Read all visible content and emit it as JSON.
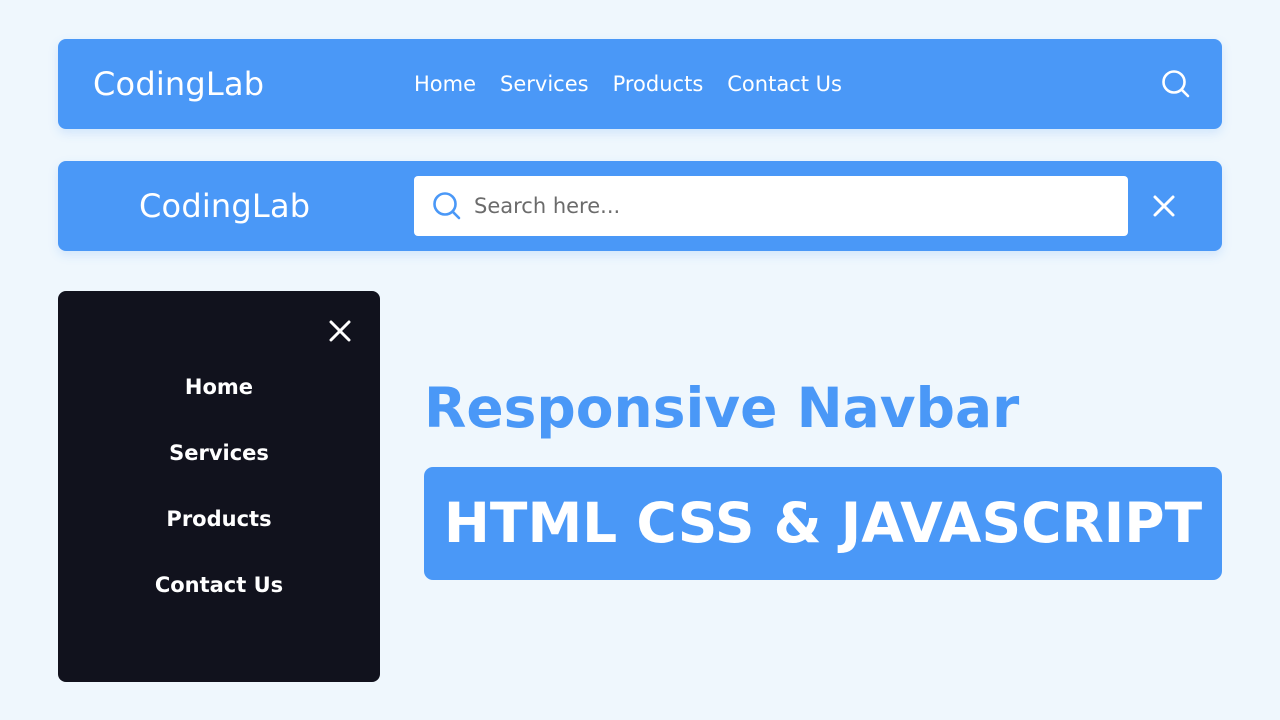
{
  "colors": {
    "background": "#EFF7FD",
    "brand_blue": "#4A98F7",
    "dark_panel": "#11121D",
    "white": "#FFFFFF"
  },
  "navbar_desktop": {
    "logo": "CodingLab",
    "links": [
      "Home",
      "Services",
      "Products",
      "Contact Us"
    ],
    "icon": "search-icon"
  },
  "navbar_search": {
    "logo": "CodingLab",
    "search_placeholder": "Search here...",
    "search_icon": "search-icon",
    "close_icon": "close-icon"
  },
  "mobile_menu": {
    "close_icon": "close-icon",
    "links": [
      "Home",
      "Services",
      "Products",
      "Contact Us"
    ]
  },
  "headline": "Responsive Navbar",
  "subheadline": "HTML CSS & JAVASCRIPT"
}
